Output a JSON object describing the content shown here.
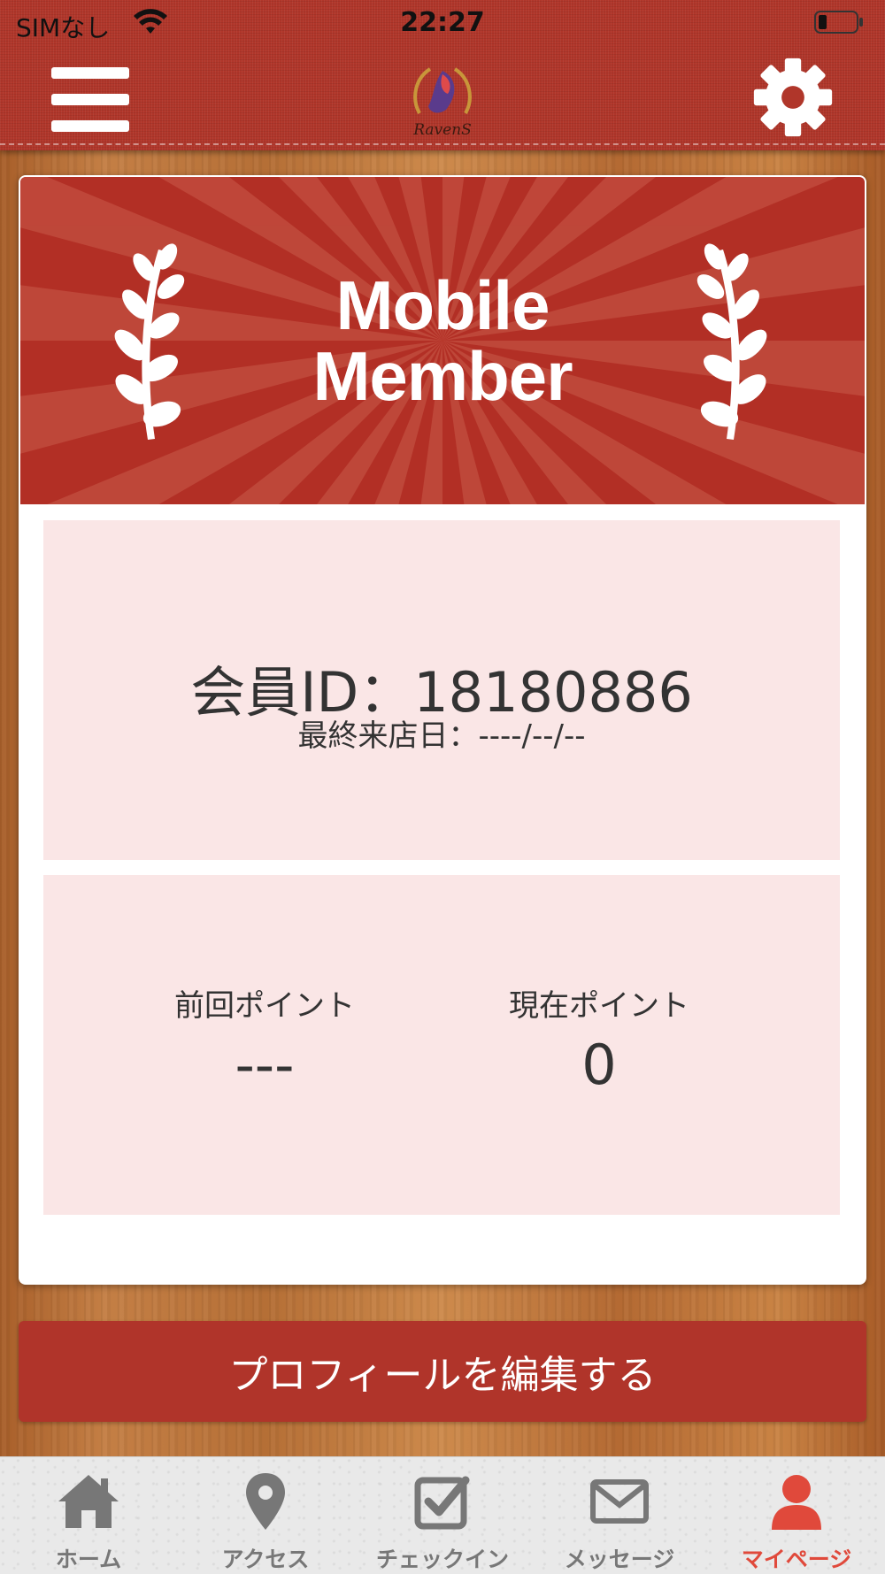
{
  "status_bar": {
    "carrier": "SIMなし",
    "time": "22:27"
  },
  "header": {
    "logo_text": "RavenS"
  },
  "banner": {
    "title_line1": "Mobile",
    "title_line2": "Member"
  },
  "member": {
    "id_text": "会員ID：18180886",
    "last_visit_text": "最終来店日：----/--/--"
  },
  "points": {
    "previous_label": "前回ポイント",
    "previous_value": "---",
    "current_label": "現在ポイント",
    "current_value": "0"
  },
  "edit_button_label": "プロフィールを編集する",
  "tabs": [
    {
      "label": "ホーム",
      "icon": "home-icon",
      "active": false
    },
    {
      "label": "アクセス",
      "icon": "location-pin-icon",
      "active": false
    },
    {
      "label": "チェックイン",
      "icon": "checkbox-icon",
      "active": false
    },
    {
      "label": "メッセージ",
      "icon": "envelope-icon",
      "active": false
    },
    {
      "label": "マイページ",
      "icon": "person-icon",
      "active": true
    }
  ],
  "colors": {
    "header_red": "#b0362a",
    "button_red": "#b0342a",
    "active_tab": "#e0493b",
    "info_box": "#fae6e6"
  }
}
